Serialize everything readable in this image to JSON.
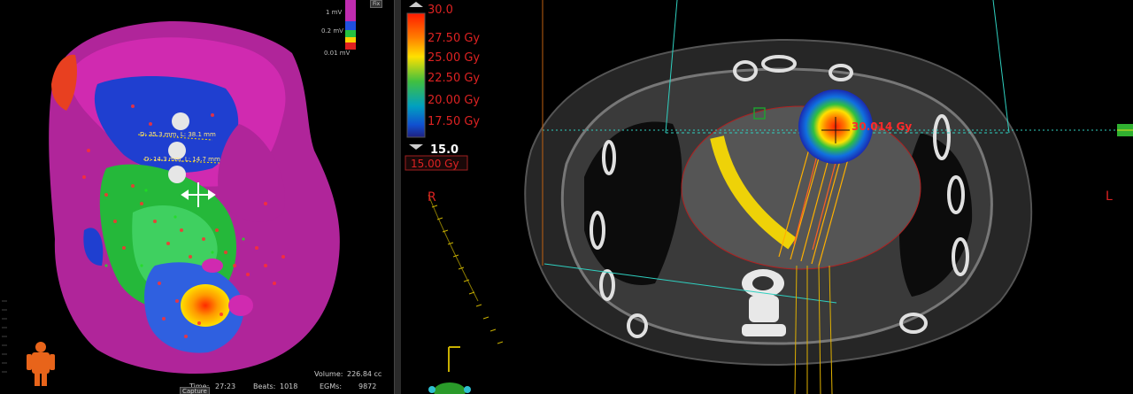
{
  "left_panel": {
    "voltage_scale": {
      "top": "1 mV",
      "mid": "0.2 mV",
      "bottom": "0.01 mV"
    },
    "top_button": "Fix",
    "measurements": [
      "D: 35.3 mm, L: 38.1 mm",
      "D: 14.3 mm, L: 14.7 mm"
    ],
    "status": {
      "volume_label": "Volume:",
      "volume_value": "226.84 cc",
      "time_label": "Time:",
      "time_value": "27:23",
      "beats_label": "Beats:",
      "beats_value": "1018",
      "egms_label": "EGMs:",
      "egms_value": "9872"
    },
    "capture_button": "Capture"
  },
  "right_panel": {
    "colorbar": {
      "max_value": "30.0",
      "labels": [
        "27.50 Gy",
        "25.00 Gy",
        "22.50 Gy",
        "20.00 Gy",
        "17.50 Gy"
      ],
      "min_value": "15.0",
      "threshold": "15.00 Gy"
    },
    "orientation_left": "R",
    "orientation_right": "L",
    "dose_point": "30.014 Gy",
    "colors": {
      "dose_label": "#dd2222",
      "accent": "#ffe000",
      "guide": "#2fd0c0"
    }
  }
}
